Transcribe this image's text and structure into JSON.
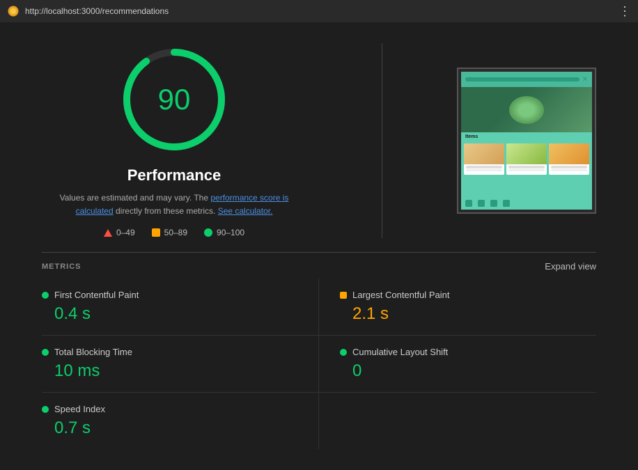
{
  "topbar": {
    "url": "http://localhost:3000/recommendations",
    "menu_icon": "⋮"
  },
  "score": {
    "value": "90",
    "title": "Performance",
    "description_text": "Values are estimated and may vary. The ",
    "description_link1": "performance score is calculated",
    "description_mid": " directly from these metrics. ",
    "description_link2": "See calculator.",
    "circle_color": "#0cce6b",
    "circle_bg": "#333"
  },
  "legend": [
    {
      "type": "triangle",
      "range": "0–49",
      "color": "#ff4e42"
    },
    {
      "type": "square",
      "range": "50–89",
      "color": "#ffa400"
    },
    {
      "type": "circle",
      "range": "90–100",
      "color": "#0cce6b"
    }
  ],
  "metrics": {
    "label": "METRICS",
    "expand_label": "Expand view",
    "items": [
      {
        "name": "First Contentful Paint",
        "value": "0.4 s",
        "status": "green",
        "dot_shape": "circle"
      },
      {
        "name": "Largest Contentful Paint",
        "value": "2.1 s",
        "status": "orange",
        "dot_shape": "square"
      },
      {
        "name": "Total Blocking Time",
        "value": "10 ms",
        "status": "green",
        "dot_shape": "circle"
      },
      {
        "name": "Cumulative Layout Shift",
        "value": "0",
        "status": "green",
        "dot_shape": "circle"
      },
      {
        "name": "Speed Index",
        "value": "0.7 s",
        "status": "green",
        "dot_shape": "circle"
      }
    ]
  }
}
